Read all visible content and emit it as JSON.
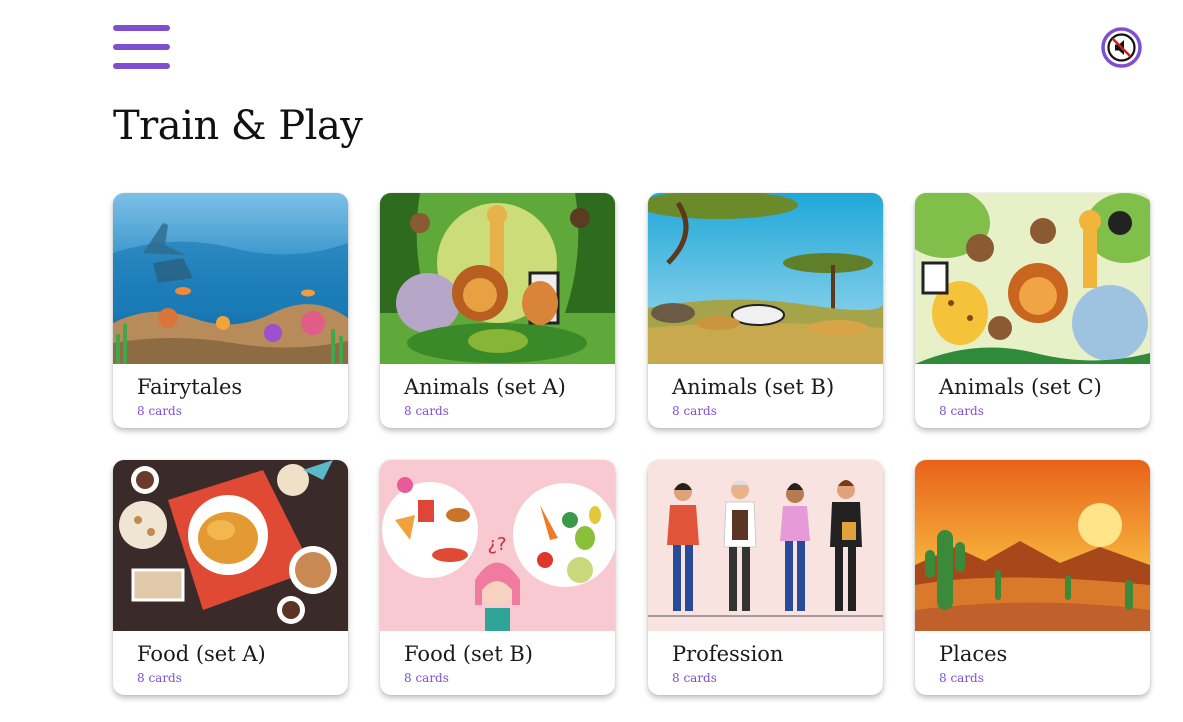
{
  "header": {
    "title": "Train & Play",
    "menu_icon": "hamburger-menu-icon",
    "sound_icon": "sound-muted-icon",
    "accent_color": "#7e4fd0"
  },
  "categories": [
    {
      "name": "Fairytales",
      "count": "8 cards"
    },
    {
      "name": "Animals (set A)",
      "count": "8 cards"
    },
    {
      "name": "Animals (set B)",
      "count": "8 cards"
    },
    {
      "name": "Animals (set C)",
      "count": "8 cards"
    },
    {
      "name": "Food (set A)",
      "count": "8 cards"
    },
    {
      "name": "Food (set B)",
      "count": "8 cards"
    },
    {
      "name": "Profession",
      "count": "8 cards"
    },
    {
      "name": "Places",
      "count": "8 cards"
    }
  ]
}
